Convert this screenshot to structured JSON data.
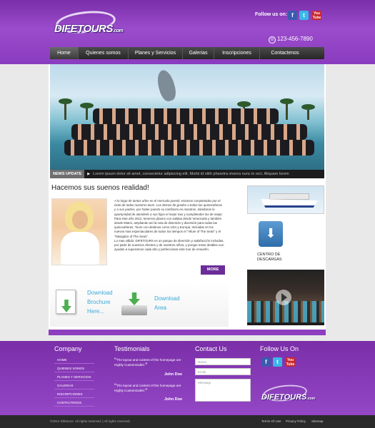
{
  "header": {
    "logo_main": "DIFETOURS",
    "logo_suffix": ".com",
    "follow_label": "Follow us on:",
    "social": {
      "facebook": "f",
      "twitter": "t",
      "youtube": "You Tube"
    },
    "phone": "123-456-7890"
  },
  "nav": [
    "Home",
    "Quienes somos",
    "Planes y Servicios",
    "Galerias",
    "Inscripciones",
    "Contactenos"
  ],
  "ticker": {
    "label": "NEWS UPDATE",
    "text": "Lorem ipsum dolor sit amet, consectetur adipiscing elit. Morbi id nibh pharetra viverra nunc in orci. Aliquam lorem"
  },
  "main": {
    "title": "Hacemos sus suenos realidad!",
    "about_p1": "A lo largo de tantos años en el mercado juvenil, estamos completados por el éxito de todos nuestros tours. Los demos de grados a todos las quinceañeras y a sus padres, por haber puesto su confianza en nosotros, dándonos la oportunidad de atenderle a sus hijas el mejor tour y cumpliendos los de mejor.",
    "about_p2": "Para este año 2012, tenemos planes con salidas desde Venezuela y también desde Miami, ampliando así la ruta de diversión y diversión para todas las quinceañeras. Tours con destinos como USA y Europa. Incluidas en los nuevos mas espectaculares de todos los tiempos el \"Allure of The Seas\" y el \"Navigator of The Seas\".",
    "about_p3": "Lo mas válido: DIFETOURS es un parque de diversión y satisfacción incluidas, por parte de nuestros clientes y de nuestros niños, y porque estos detalles nos ayudan a superarnos cada año y perfeccionar este tour de ensueño.",
    "more_label": "MORE",
    "download_brochure": [
      "Download",
      "Brochure",
      "Here..."
    ],
    "download_area": [
      "Download",
      "Area"
    ]
  },
  "sidebar": {
    "descargas_line1": "CENTRO DE",
    "descargas_line2": "DESCARGAS"
  },
  "footer": {
    "company_title": "Company",
    "company_links": [
      "HOME",
      "QUIENES SOMOS",
      "PLANES Y SERVICIOS",
      "GALERIAS",
      "INSCRIPCIONES",
      "CONTACTENOS"
    ],
    "testimonials_title": "Testimonials",
    "testimonials": [
      {
        "text": "The layout and content of the homepage are Highly Customizable.",
        "author": "John Doe"
      },
      {
        "text": "The layout and content of the homepage are Highly Customizable.",
        "author": "John Doe"
      }
    ],
    "contact_title": "Contact Us",
    "contact_placeholders": {
      "name": "Name",
      "email": "Email",
      "message": "Message"
    },
    "follow_title": "Follow Us On",
    "logo_main": "DIFETOURS",
    "logo_suffix": ".com"
  },
  "bottom": {
    "copyright": "©2012 Difetours. All rights reserved. | All rights reserved.",
    "links": [
      "Terms Of Use",
      "Privacy Policy",
      "Sitemap"
    ]
  },
  "colors": {
    "brand_purple": "#8e3fc0",
    "dark_purple": "#6c2d99",
    "link_blue": "#39a9d8"
  }
}
